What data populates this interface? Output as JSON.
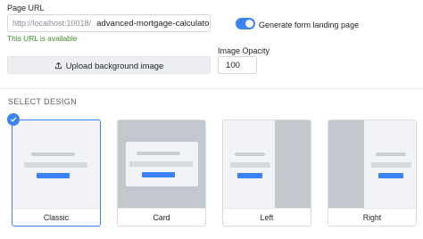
{
  "page_url": {
    "label": "Page URL",
    "prefix": "http://localhost:10018/",
    "slug": "advanced-mortgage-calculato",
    "status": "This URL is available"
  },
  "landing_toggle": {
    "label": "Generate form landing page",
    "on": true
  },
  "upload": {
    "label": "Upload background image",
    "icon": "upload-icon"
  },
  "opacity": {
    "label": "Image Opacity",
    "value": "100"
  },
  "design": {
    "section_title": "SELECT DESIGN",
    "selected": "Classic",
    "options": [
      {
        "label": "Classic"
      },
      {
        "label": "Card"
      },
      {
        "label": "Left"
      },
      {
        "label": "Right"
      }
    ]
  },
  "colors": {
    "accent": "#3b82f6",
    "success": "#3d8a2e"
  }
}
